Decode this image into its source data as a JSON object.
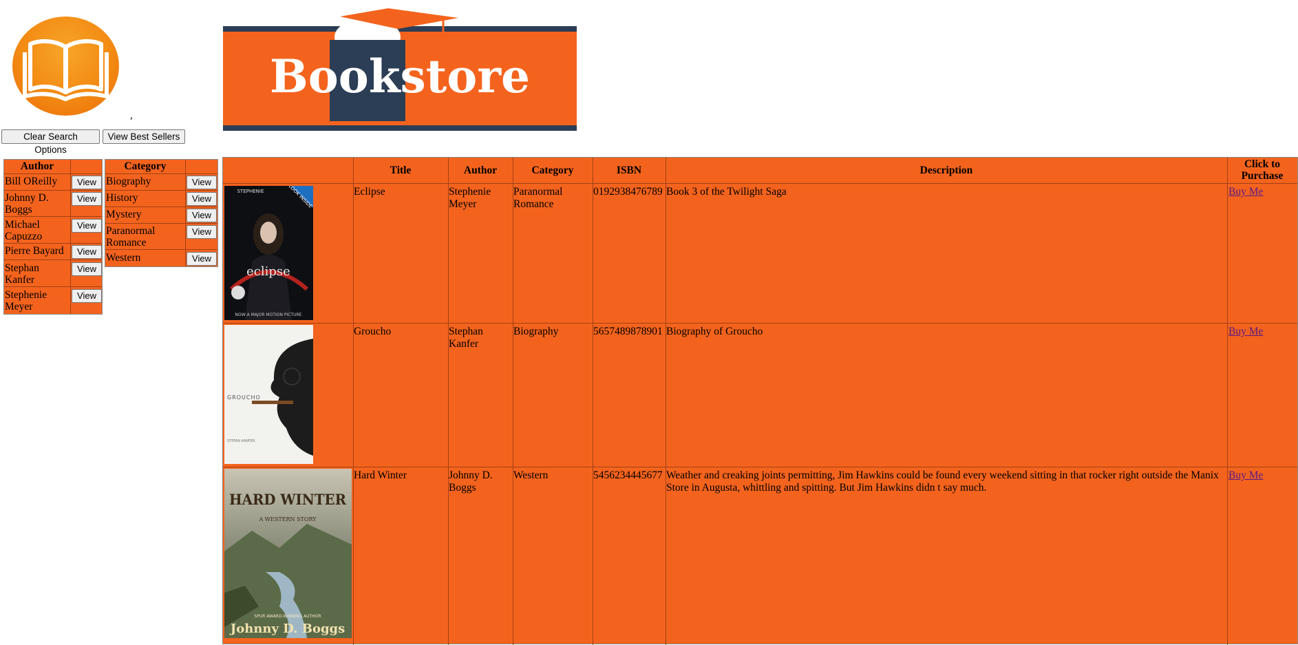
{
  "header": {
    "comma_text": ",",
    "banner_text": "Bookstore"
  },
  "buttons": {
    "clear_label": "Clear Search Options",
    "best_label": "View Best Sellers"
  },
  "author_table": {
    "header": "Author",
    "view_label": "View",
    "rows": [
      "Bill OReilly",
      "Johnny D. Boggs",
      "Michael Capuzzo",
      "Pierre Bayard",
      "Stephan Kanfer",
      "Stephenie Meyer"
    ]
  },
  "category_table": {
    "header": "Category",
    "view_label": "View",
    "rows": [
      "Biography",
      "History",
      "Mystery",
      "Paranormal Romance",
      "Western"
    ]
  },
  "books_table": {
    "headers": [
      "Title",
      "Author",
      "Category",
      "ISBN",
      "Description",
      "Click to Purchase"
    ],
    "buy_label": "Buy Me",
    "rows": [
      {
        "title": "Eclipse",
        "author": "Stephenie Meyer",
        "category": "Paranormal Romance",
        "isbn": "0192938476789",
        "description": "Book 3 of the Twilight Saga",
        "cover_text_top": "STEPHENIE",
        "cover_text_title": "eclipse",
        "cover_text_badge": "LOOK INSIDE",
        "cover_text_bottom": "NOW A MAJOR MOTION PICTURE"
      },
      {
        "title": "Groucho",
        "author": "Stephan Kanfer",
        "category": "Biography",
        "isbn": "5657489878901",
        "description": "Biography of Groucho",
        "cover_text_title": "GROUCHO",
        "cover_text_bottom": "STEFAN KANFER"
      },
      {
        "title": "Hard Winter",
        "author": "Johnny D. Boggs",
        "category": "Western",
        "isbn": "5456234445677",
        "description": "Weather and creaking joints permitting, Jim Hawkins could be found every weekend sitting in that rocker right outside the Manix Store in Augusta, whittling and spitting. But Jim Hawkins didn t say much.",
        "cover_text_title": "HARD WINTER",
        "cover_text_sub": "A WESTERN STORY",
        "cover_text_award": "SPUR AWARD-WINNING AUTHOR",
        "cover_text_author": "Johnny D. Boggs"
      }
    ]
  }
}
